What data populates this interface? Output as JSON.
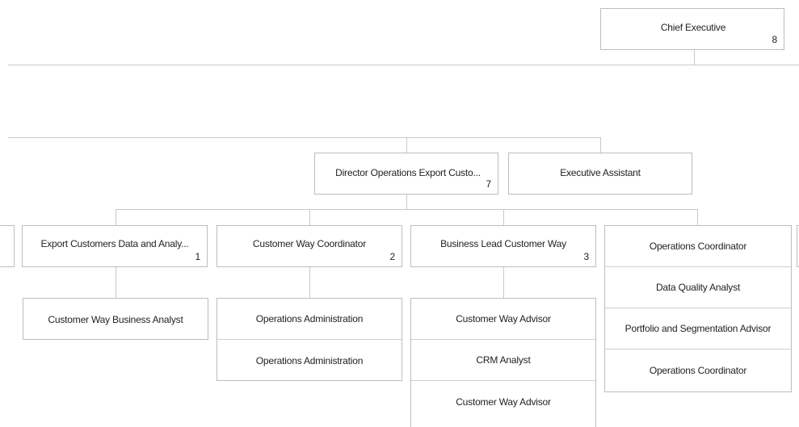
{
  "root": {
    "title": "Chief Executive",
    "count": "8"
  },
  "level1": [
    {
      "title": "Director Operations Export Custo...",
      "count": "7"
    },
    {
      "title": "Executive Assistant",
      "count": ""
    }
  ],
  "level2": [
    {
      "title": "Export Customers Data and Analy...",
      "count": "1",
      "children": [
        "Customer Way Business Analyst"
      ]
    },
    {
      "title": "Customer Way Coordinator",
      "count": "2",
      "children": [
        "Operations Administration",
        "Operations Administration"
      ]
    },
    {
      "title": "Business Lead Customer Way",
      "count": "3",
      "children": [
        "Customer Way Advisor",
        "CRM Analyst",
        "Customer Way Advisor"
      ]
    },
    {
      "title": "Operations Coordinator",
      "count": "",
      "children": [
        "Data Quality Analyst",
        "Portfolio and Segmentation Advisor",
        "Operations Coordinator"
      ]
    }
  ]
}
